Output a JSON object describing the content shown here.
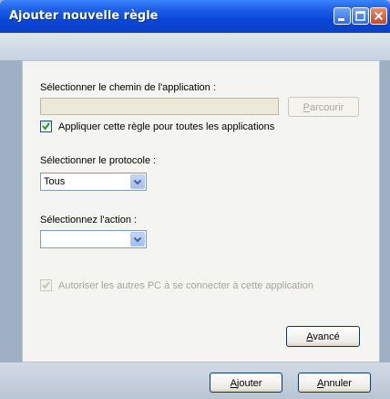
{
  "window": {
    "title": "Ajouter nouvelle règle"
  },
  "path_section": {
    "label": "Sélectionner le chemin de l'application :",
    "path_value": "",
    "browse_label_prefix": "",
    "browse_label_mnemonic": "P",
    "browse_label_suffix": "arcourir",
    "apply_all_label": "Appliquer cette règle pour toutes les applications",
    "apply_all_checked": true
  },
  "protocol_section": {
    "label": "Sélectionner le protocole :",
    "selected": "Tous"
  },
  "action_section": {
    "label": "Sélectionnez l'action :",
    "selected": ""
  },
  "allow_pc": {
    "label": "Autoriser les autres PC à se connecter à cette application",
    "checked": true,
    "disabled": true
  },
  "advanced_button": {
    "mnemonic": "A",
    "suffix": "vancé"
  },
  "footer": {
    "add_mnemonic": "A",
    "add_suffix": "jouter",
    "cancel_mnemonic": "A",
    "cancel_suffix": "nnuler"
  },
  "colors": {
    "title_bar": "#0a47d8",
    "panel_bg": "#f4f4f0",
    "disabled_text": "#a7a69a"
  }
}
